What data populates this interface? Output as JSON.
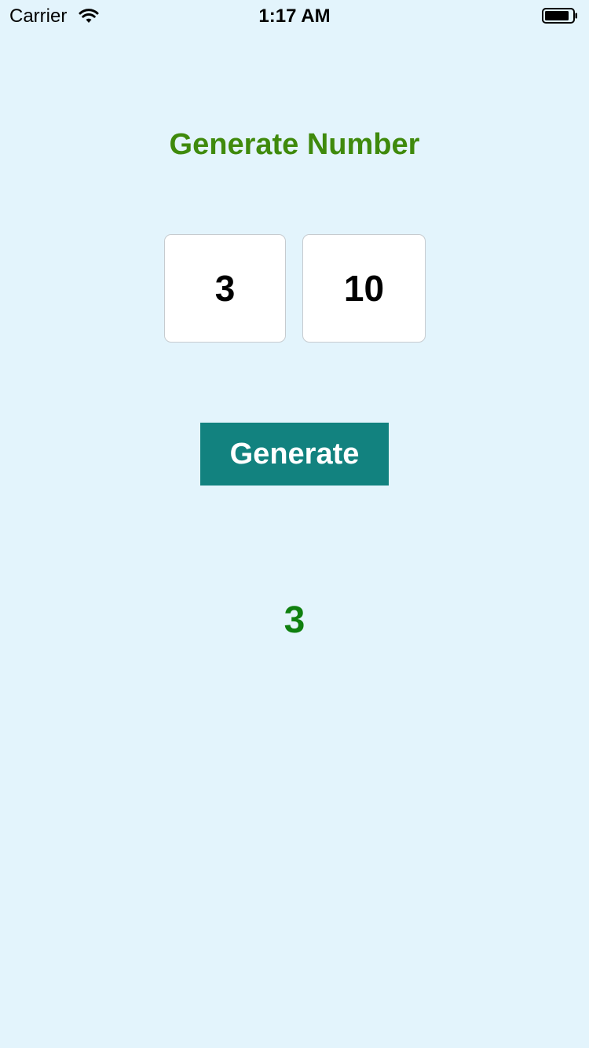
{
  "status_bar": {
    "carrier": "Carrier",
    "time": "1:17 AM",
    "wifi_icon": "wifi-icon",
    "battery_icon": "battery-icon"
  },
  "title": "Generate Number",
  "inputs": {
    "min_value": "3",
    "max_value": "10"
  },
  "generate_button": {
    "label": "Generate"
  },
  "result": "3",
  "colors": {
    "background": "#e3f4fc",
    "title": "#3f8a0c",
    "button": "#12827f",
    "result": "#0f800f"
  }
}
